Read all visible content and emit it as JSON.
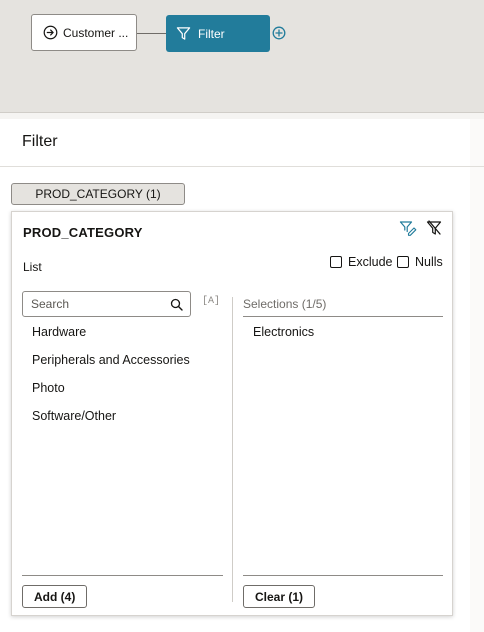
{
  "flow": {
    "source_node_label": "Customer ...",
    "filter_node_label": "Filter",
    "colors": {
      "canvas": "#e5e3df",
      "filter_node": "#227c9b",
      "add_icon": "#227c9b"
    }
  },
  "panel": {
    "title": "Filter"
  },
  "filter_chip": {
    "label": "PROD_CATEGORY (1)"
  },
  "filter_card": {
    "column_name": "PROD_CATEGORY",
    "mode_label": "List",
    "exclude_label": "Exclude",
    "exclude_checked": false,
    "nulls_label": "Nulls",
    "nulls_checked": false,
    "search_placeholder": "Search",
    "case_toggle_label": "[A]",
    "available_items": [
      "Hardware",
      "Peripherals and Accessories",
      "Photo",
      "Software/Other"
    ],
    "selections_header": "Selections (1/5)",
    "selected_items": [
      "Electronics"
    ],
    "add_button_label": "Add (4)",
    "clear_button_label": "Clear (1)"
  }
}
